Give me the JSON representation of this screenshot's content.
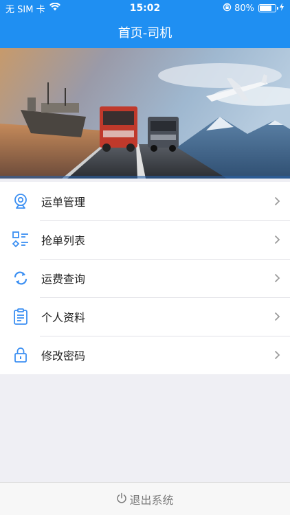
{
  "status_bar": {
    "carrier": "无 SIM 卡",
    "time": "15:02",
    "battery_percent": "80%",
    "battery_level": 0.8,
    "icons": [
      "wifi-icon",
      "orientation-lock-icon",
      "battery-icon",
      "charging-icon"
    ]
  },
  "nav": {
    "title": "首页-司机"
  },
  "banner": {
    "image": "logistics banner: cargo ship, trucks, airplane, mountains"
  },
  "menu": {
    "items": [
      {
        "label": "运单管理",
        "icon": "webcam-icon"
      },
      {
        "label": "抢单列表",
        "icon": "list-grid-icon"
      },
      {
        "label": "运费查询",
        "icon": "refresh-icon"
      },
      {
        "label": "个人资料",
        "icon": "clipboard-icon"
      },
      {
        "label": "修改密码",
        "icon": "lock-icon"
      }
    ]
  },
  "logout": {
    "label": "退出系统",
    "icon": "power-icon"
  },
  "colors": {
    "primary": "#1f8ff2",
    "icon_blue": "#3b8ff2",
    "background": "#efeff4"
  }
}
